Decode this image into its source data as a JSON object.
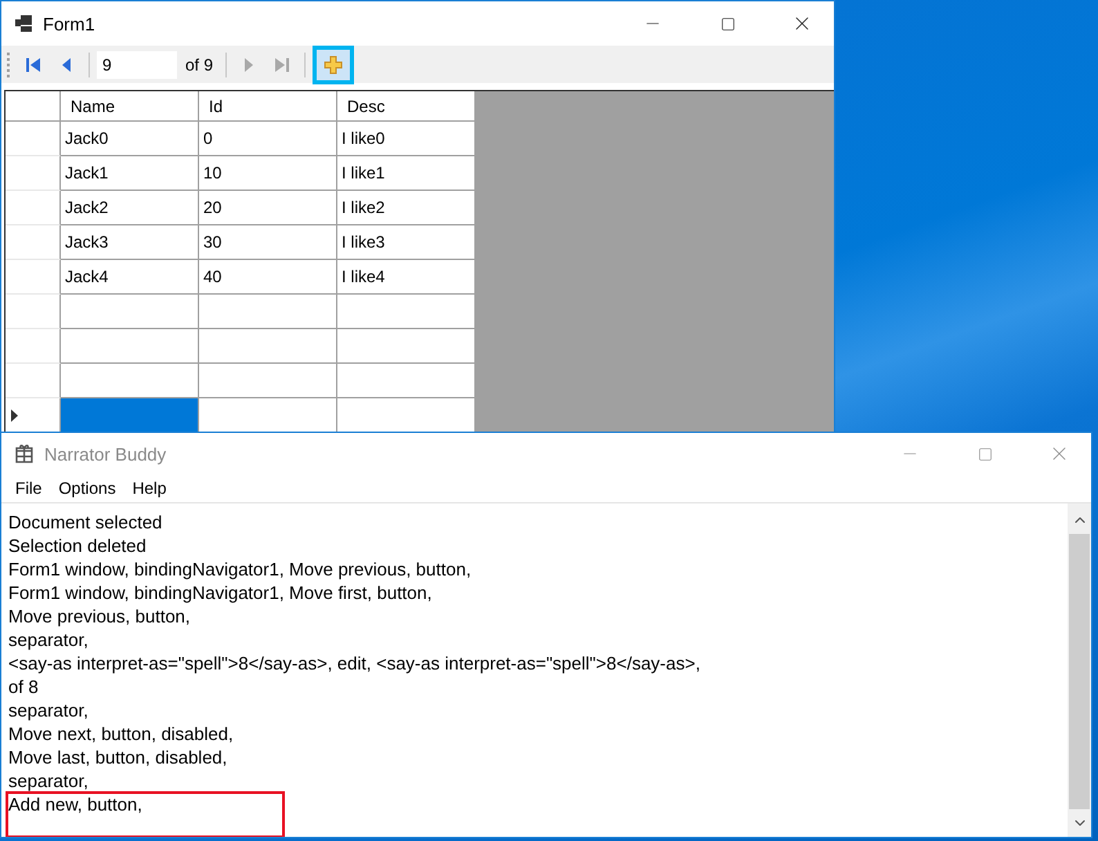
{
  "form_window": {
    "title": "Form1",
    "navigator": [
      {
        "kind": "first",
        "disabled": false
      },
      {
        "kind": "previous",
        "disabled": false
      },
      {
        "kind": "separator"
      },
      {
        "kind": "position",
        "value": "9"
      },
      {
        "kind": "count",
        "text": "of 9"
      },
      {
        "kind": "separator"
      },
      {
        "kind": "next",
        "disabled": true
      },
      {
        "kind": "last",
        "disabled": true
      },
      {
        "kind": "separator"
      },
      {
        "kind": "add",
        "disabled": false,
        "focused": true
      }
    ],
    "grid": {
      "columns": [
        "Name",
        "Id",
        "Desc"
      ],
      "rows": [
        {
          "current": false,
          "cells": [
            {
              "text": "Jack0",
              "selected": false
            },
            {
              "text": "0",
              "selected": false
            },
            {
              "text": "I like0",
              "selected": false
            }
          ]
        },
        {
          "current": false,
          "cells": [
            {
              "text": "Jack1",
              "selected": false
            },
            {
              "text": "10",
              "selected": false
            },
            {
              "text": "I like1",
              "selected": false
            }
          ]
        },
        {
          "current": false,
          "cells": [
            {
              "text": "Jack2",
              "selected": false
            },
            {
              "text": "20",
              "selected": false
            },
            {
              "text": "I like2",
              "selected": false
            }
          ]
        },
        {
          "current": false,
          "cells": [
            {
              "text": "Jack3",
              "selected": false
            },
            {
              "text": "30",
              "selected": false
            },
            {
              "text": "I like3",
              "selected": false
            }
          ]
        },
        {
          "current": false,
          "cells": [
            {
              "text": "Jack4",
              "selected": false
            },
            {
              "text": "40",
              "selected": false
            },
            {
              "text": "I like4",
              "selected": false
            }
          ]
        },
        {
          "current": false,
          "cells": [
            {
              "selected": false
            },
            {
              "selected": false
            },
            {
              "selected": false
            }
          ]
        },
        {
          "current": false,
          "cells": [
            {
              "selected": false
            },
            {
              "selected": false
            },
            {
              "selected": false
            }
          ]
        },
        {
          "current": false,
          "cells": [
            {
              "selected": false
            },
            {
              "selected": false
            },
            {
              "selected": false
            }
          ]
        },
        {
          "current": true,
          "cells": [
            {
              "selected": true
            },
            {
              "selected": false
            },
            {
              "selected": false
            }
          ]
        }
      ]
    }
  },
  "narrator_window": {
    "title": "Narrator Buddy",
    "menu": [
      "File",
      "Options",
      "Help"
    ],
    "log": [
      {
        "text": "Document selected",
        "highlighted": false
      },
      {
        "text": "Selection deleted",
        "highlighted": false
      },
      {
        "text": "Form1 window, bindingNavigator1, Move previous, button,",
        "highlighted": false
      },
      {
        "text": "Form1 window, bindingNavigator1, Move first, button,",
        "highlighted": false
      },
      {
        "text": "Move previous, button,",
        "highlighted": false
      },
      {
        "text": "separator,",
        "highlighted": false
      },
      {
        "text": "<say-as interpret-as=\"spell\">8</say-as>, edit, <say-as interpret-as=\"spell\">8</say-as>,",
        "highlighted": false
      },
      {
        "text": "of 8",
        "highlighted": false
      },
      {
        "text": "separator,",
        "highlighted": false
      },
      {
        "text": "Move next, button, disabled,",
        "highlighted": false
      },
      {
        "text": "Move last, button, disabled,",
        "highlighted": false
      },
      {
        "text": "separator,",
        "highlighted": false
      },
      {
        "text": "Add new, button,",
        "highlighted": true
      }
    ]
  }
}
